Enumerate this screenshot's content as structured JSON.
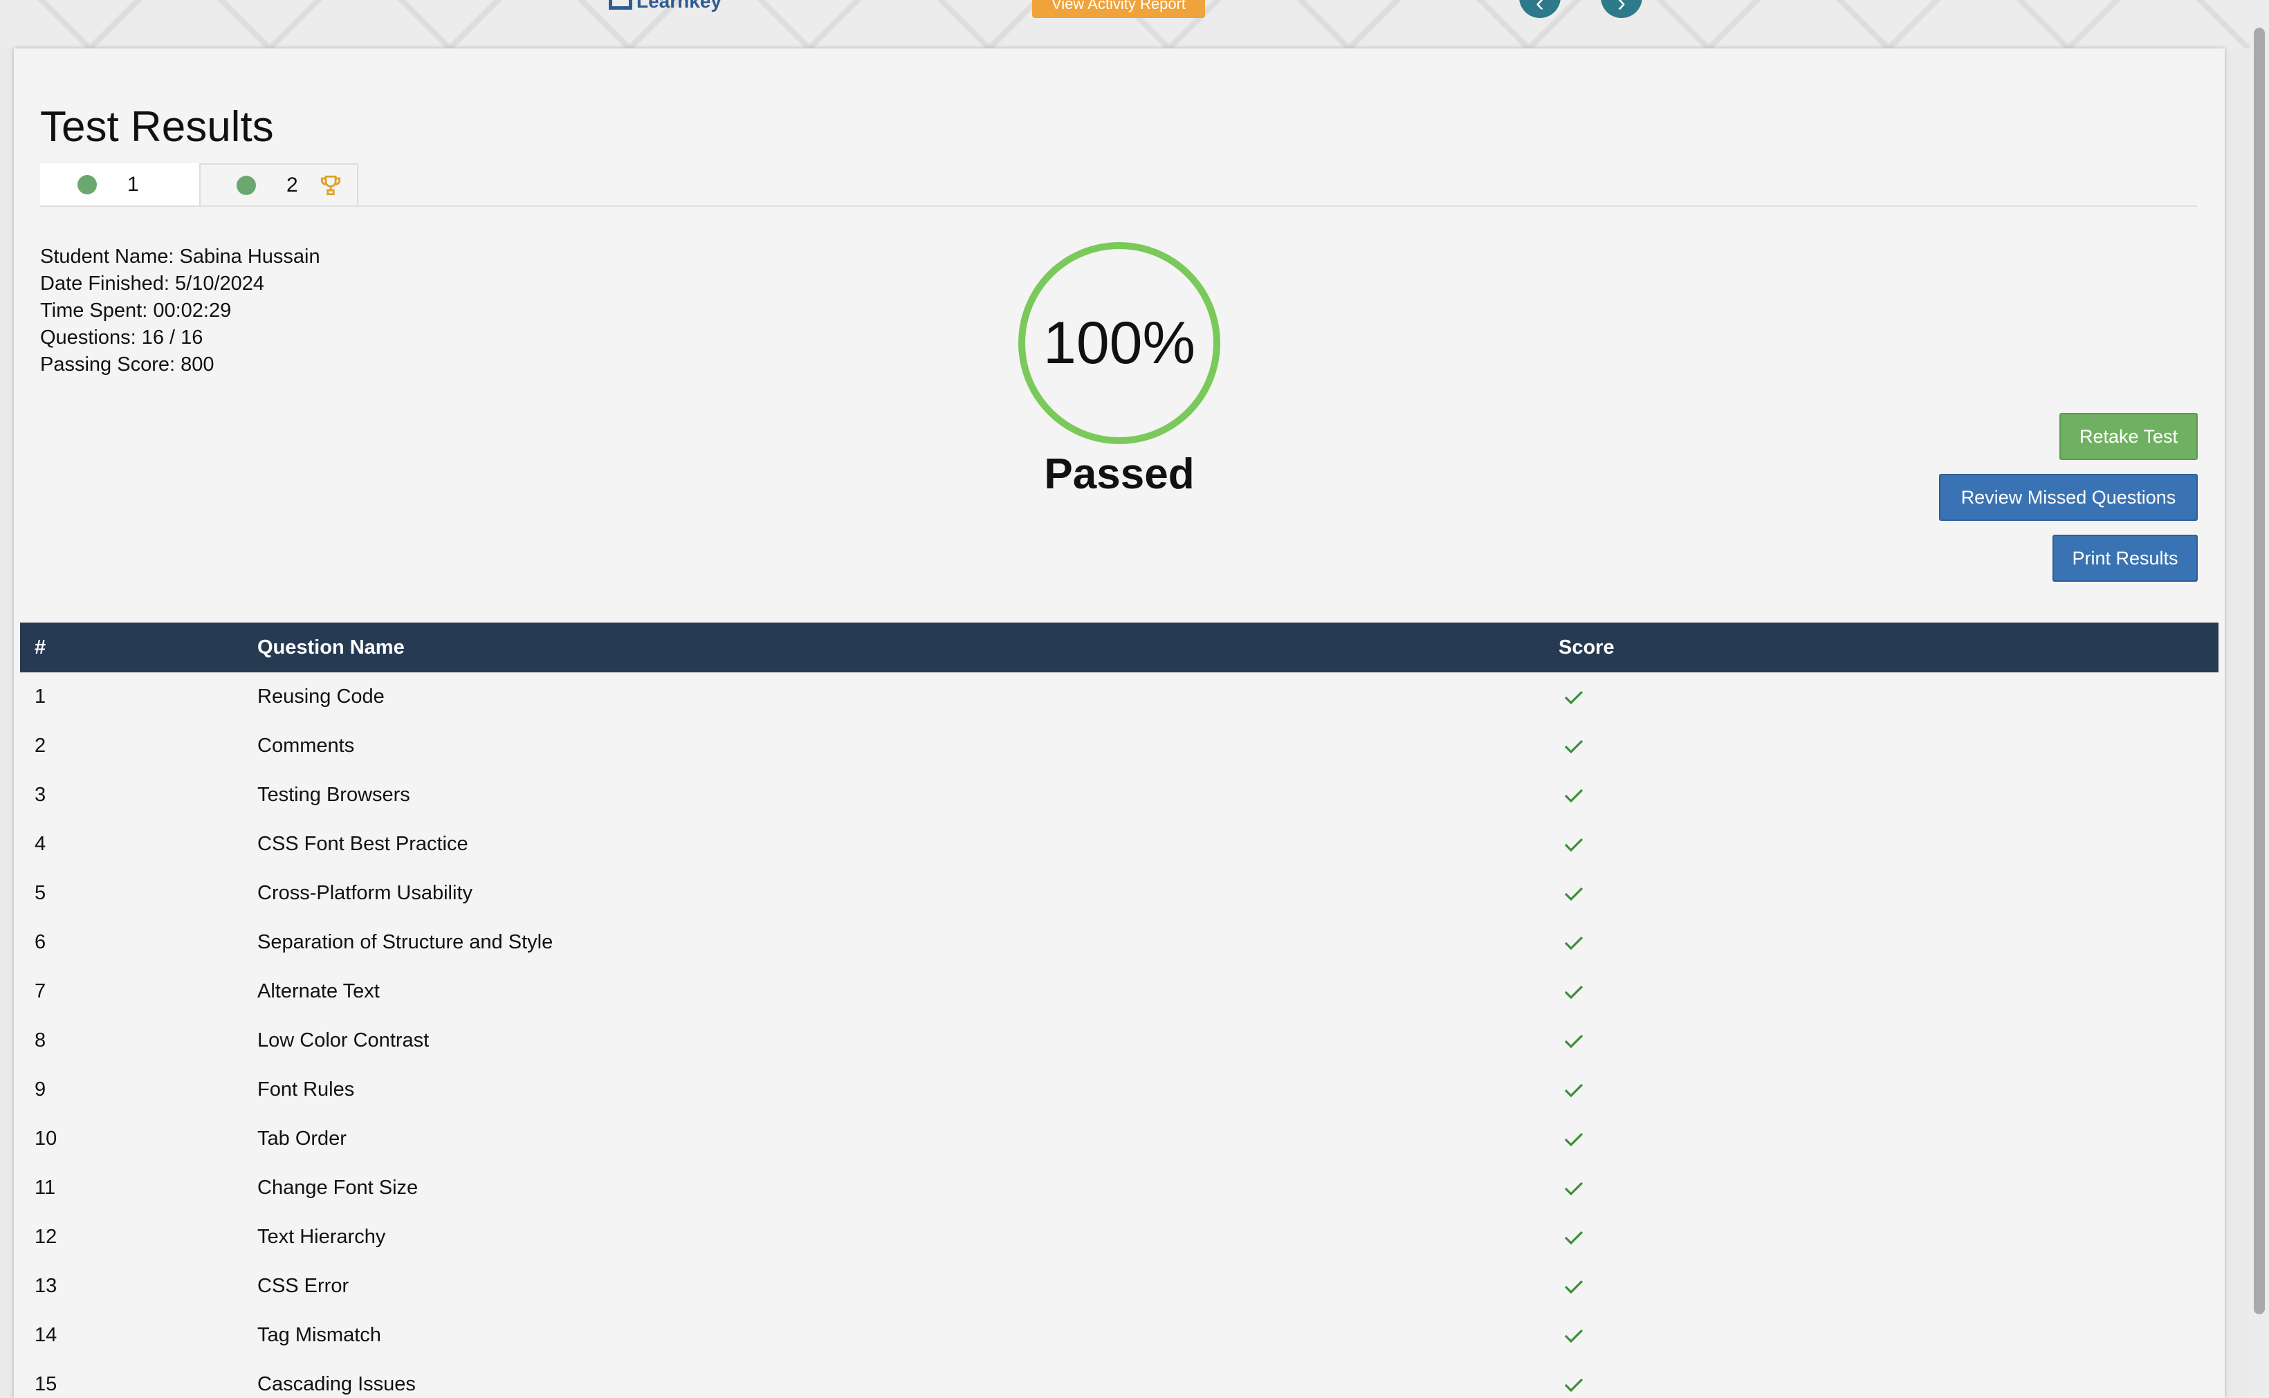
{
  "header": {
    "logo_text": "Learnkey",
    "activity_report_label": "View Activity Report",
    "prev_icon": "chevron-left-icon",
    "next_icon": "chevron-right-icon"
  },
  "page": {
    "title": "Test Results",
    "tabs": [
      {
        "label": "1",
        "active": false,
        "dot_color": "#6aa86f"
      },
      {
        "label": "2",
        "active": true,
        "dot_color": "#6aa86f",
        "icon": "trophy-icon"
      }
    ]
  },
  "student": {
    "name": "Student Name: Sabina Hussain",
    "date_finished": "Date Finished: 5/10/2024",
    "time_spent": "Time Spent: 00:02:29",
    "questions": "Questions: 16 / 16",
    "passing_score": "Passing Score: 800"
  },
  "result": {
    "percent": "100%",
    "status": "Passed",
    "ring_color": "#7bc95a"
  },
  "actions": {
    "retake": "Retake Test",
    "review": "Review Missed Questions",
    "print": "Print Results"
  },
  "table": {
    "headers": [
      "#",
      "Question Name",
      "Score"
    ],
    "rows": [
      {
        "num": "1",
        "name": "Reusing Code",
        "score": "check-icon"
      },
      {
        "num": "2",
        "name": "Comments",
        "score": "check-icon"
      },
      {
        "num": "3",
        "name": "Testing Browsers",
        "score": "check-icon"
      },
      {
        "num": "4",
        "name": "CSS Font Best Practice",
        "score": "check-icon"
      },
      {
        "num": "5",
        "name": "Cross-Platform Usability",
        "score": "check-icon"
      },
      {
        "num": "6",
        "name": "Separation of Structure and Style",
        "score": "check-icon"
      },
      {
        "num": "7",
        "name": "Alternate Text",
        "score": "check-icon"
      },
      {
        "num": "8",
        "name": "Low Color Contrast",
        "score": "check-icon"
      },
      {
        "num": "9",
        "name": "Font Rules",
        "score": "check-icon"
      },
      {
        "num": "10",
        "name": "Tab Order",
        "score": "check-icon"
      },
      {
        "num": "11",
        "name": "Change Font Size",
        "score": "check-icon"
      },
      {
        "num": "12",
        "name": "Text Hierarchy",
        "score": "check-icon"
      },
      {
        "num": "13",
        "name": "CSS Error",
        "score": "check-icon"
      },
      {
        "num": "14",
        "name": "Tag Mismatch",
        "score": "check-icon"
      },
      {
        "num": "15",
        "name": "Cascading Issues",
        "score": "check-icon"
      }
    ]
  },
  "colors": {
    "header_bg": "#263a52",
    "check": "#3e8e3a",
    "retake": "#70b062",
    "primary": "#3a73b3",
    "activity": "#f0a23b"
  }
}
